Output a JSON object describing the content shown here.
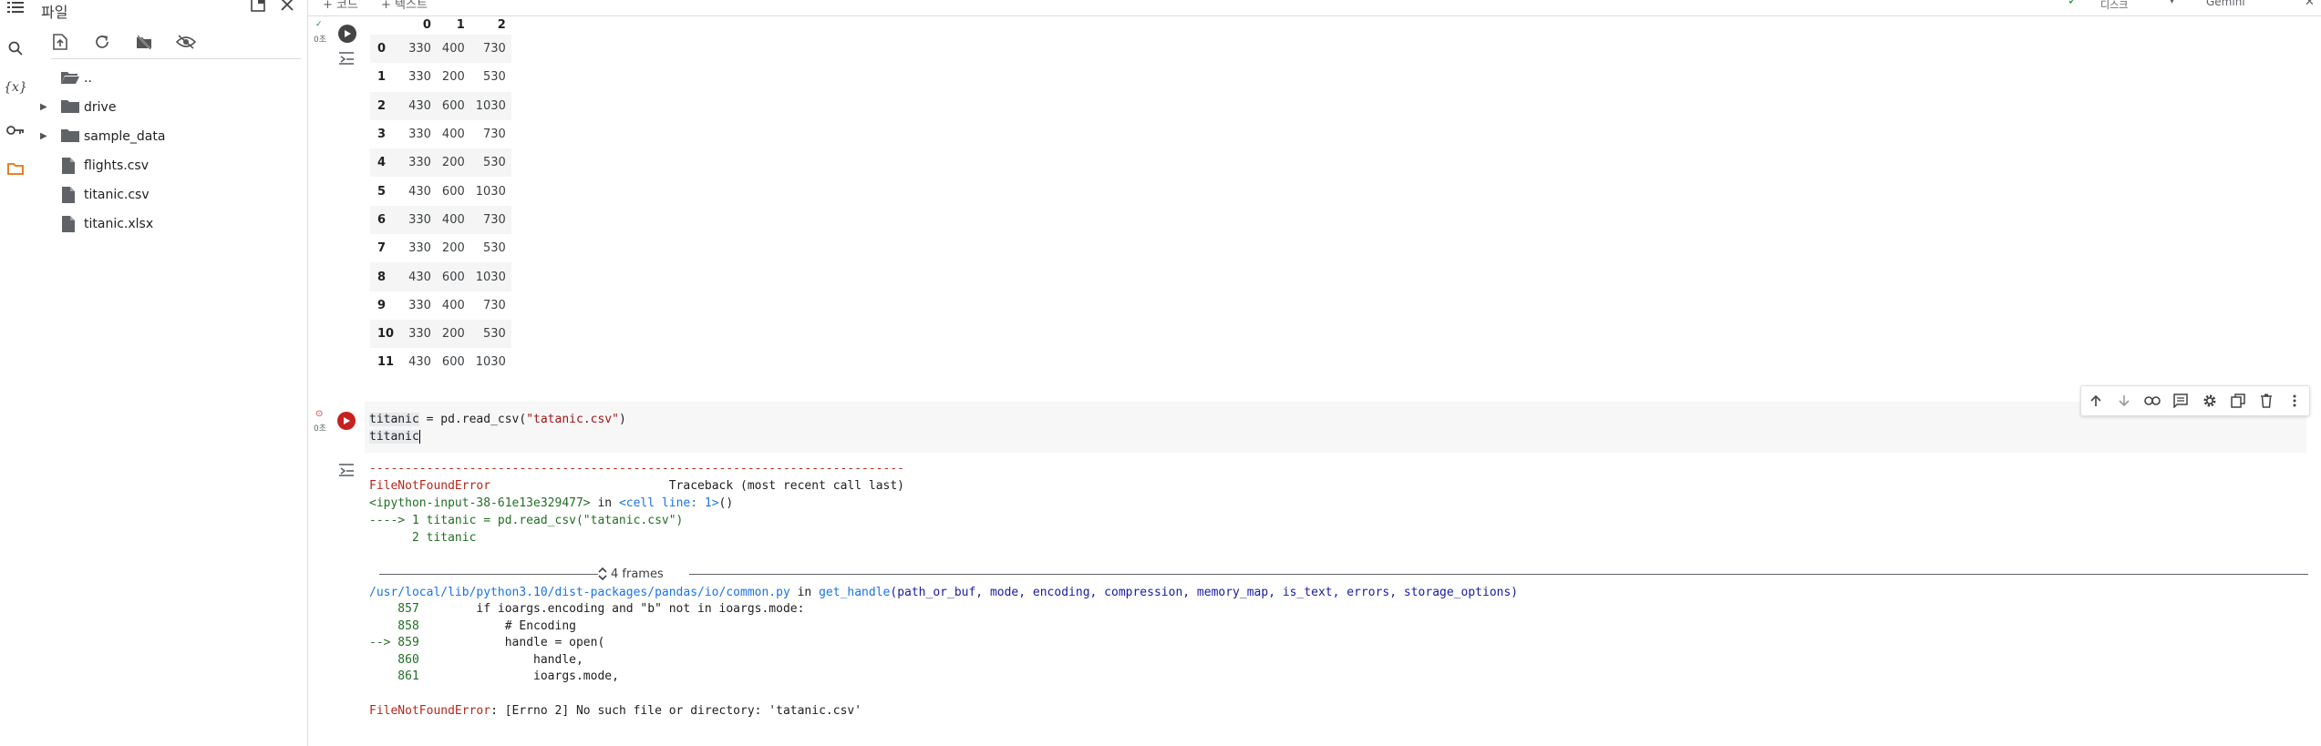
{
  "panel": {
    "title": "파일",
    "tree": [
      {
        "label": "..",
        "kind": "folder-up"
      },
      {
        "label": "drive",
        "kind": "folder"
      },
      {
        "label": "sample_data",
        "kind": "folder"
      },
      {
        "label": "flights.csv",
        "kind": "file"
      },
      {
        "label": "titanic.csv",
        "kind": "file"
      },
      {
        "label": "titanic.xlsx",
        "kind": "file"
      }
    ]
  },
  "topbar": {
    "code_label": "+ 코드",
    "text_label": "+ 텍스트",
    "disk_label": "디스크",
    "gemini_label": "Gemini"
  },
  "cell1": {
    "status": "0초",
    "columns": [
      "0",
      "1",
      "2"
    ],
    "rows": [
      [
        "0",
        "330",
        "400",
        "730"
      ],
      [
        "1",
        "330",
        "200",
        "530"
      ],
      [
        "2",
        "430",
        "600",
        "1030"
      ],
      [
        "3",
        "330",
        "400",
        "730"
      ],
      [
        "4",
        "330",
        "200",
        "530"
      ],
      [
        "5",
        "430",
        "600",
        "1030"
      ],
      [
        "6",
        "330",
        "400",
        "730"
      ],
      [
        "7",
        "330",
        "200",
        "530"
      ],
      [
        "8",
        "430",
        "600",
        "1030"
      ],
      [
        "9",
        "330",
        "400",
        "730"
      ],
      [
        "10",
        "330",
        "200",
        "530"
      ],
      [
        "11",
        "430",
        "600",
        "1030"
      ]
    ]
  },
  "cell2": {
    "status": "0초",
    "line1_var": "titanic",
    "line1_mid": " = pd.read_csv(",
    "line1_str": "\"tatanic.csv\"",
    "line1_end": ")",
    "line2": "titanic"
  },
  "traceback": {
    "dashes": "---------------------------------------------------------------------------",
    "error_name": "FileNotFoundError",
    "traceback_header": "                         Traceback (most recent call last)",
    "input_ref": "<ipython-input-38-61e13e329477>",
    "in_text": " in ",
    "cell_line": "<cell line: 1>",
    "paren": "()",
    "arrow_line": "----> 1 titanic = pd.read_csv(\"tatanic.csv\")",
    "line2": "      2 titanic",
    "frames": "4 frames",
    "file_path": "/usr/local/lib/python3.10/dist-packages/pandas/io/common.py",
    "func_name": "get_handle",
    "func_args": "(path_or_buf, mode, encoding, compression, memory_map, is_text, errors, storage_options)",
    "src": [
      {
        "arrow": "   ",
        "num": " 857",
        "code": "        if ioargs.encoding and \"b\" not in ioargs.mode:"
      },
      {
        "arrow": "   ",
        "num": " 858",
        "code": "            # Encoding"
      },
      {
        "arrow": "-->",
        "num": " 859",
        "code": "            handle = open("
      },
      {
        "arrow": "   ",
        "num": " 860",
        "code": "                handle,"
      },
      {
        "arrow": "   ",
        "num": " 861",
        "code": "                ioargs.mode,"
      }
    ],
    "final_error_name": "FileNotFoundError",
    "final_error_msg": ": [Errno 2] No such file or directory: 'tatanic.csv'"
  }
}
